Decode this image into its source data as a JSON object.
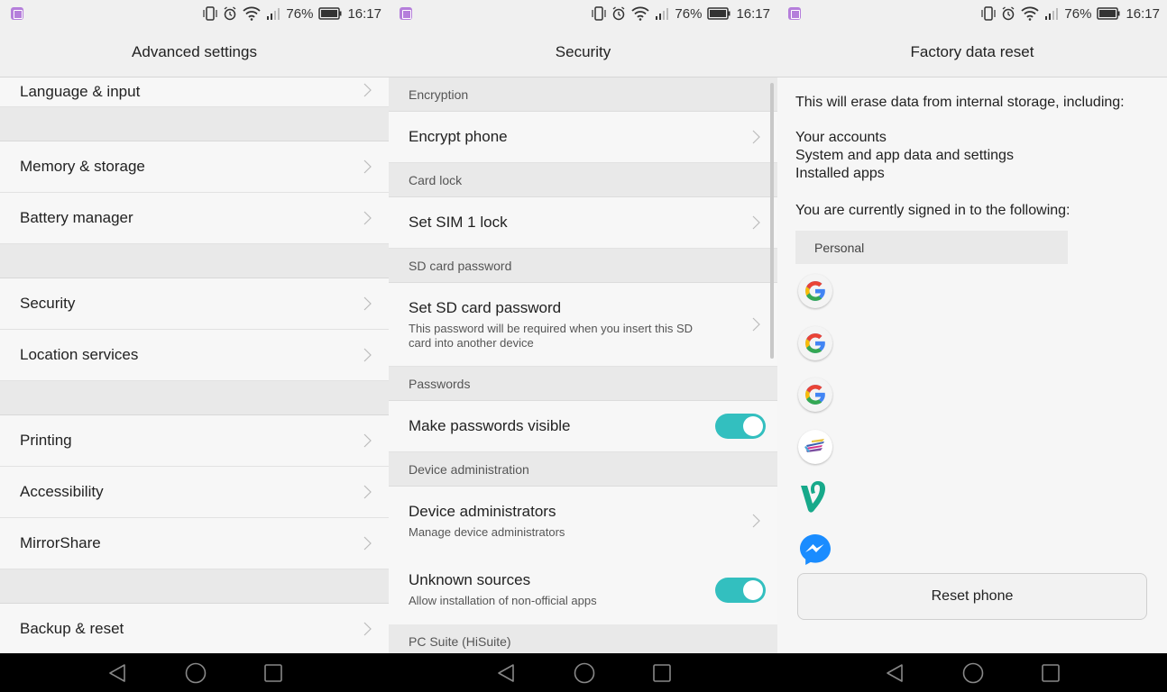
{
  "status_bar": {
    "battery_percent": "76%",
    "time": "16:17",
    "icons": [
      "gallery-notification-icon",
      "vibrate-icon",
      "alarm-icon",
      "wifi-icon",
      "signal-icon",
      "battery-icon"
    ]
  },
  "screens": [
    {
      "title": "Advanced settings",
      "items": [
        {
          "label": "Language & input"
        },
        {
          "label": "Memory & storage"
        },
        {
          "label": "Battery manager"
        },
        {
          "label": "Security"
        },
        {
          "label": "Location services"
        },
        {
          "label": "Printing"
        },
        {
          "label": "Accessibility"
        },
        {
          "label": "MirrorShare"
        },
        {
          "label": "Backup & reset"
        }
      ]
    },
    {
      "title": "Security",
      "sections": {
        "encryption": "Encryption",
        "card_lock": "Card lock",
        "sd_card_password": "SD card password",
        "passwords": "Passwords",
        "device_admin": "Device administration",
        "pc_suite": "PC Suite (HiSuite)"
      },
      "items": {
        "encrypt_phone": {
          "label": "Encrypt phone"
        },
        "set_sim_lock": {
          "label": "Set SIM 1 lock"
        },
        "set_sd_password": {
          "label": "Set SD card password",
          "sub": "This password will be required when you insert this SD card into another device"
        },
        "make_passwords_visible": {
          "label": "Make passwords visible",
          "on": true
        },
        "device_administrators": {
          "label": "Device administrators",
          "sub": "Manage device administrators"
        },
        "unknown_sources": {
          "label": "Unknown sources",
          "sub": "Allow installation of non-official apps",
          "on": true
        }
      },
      "toggle_color": "#33bfbf"
    },
    {
      "title": "Factory data reset",
      "intro": "This will erase data from internal storage, including:",
      "erase_list": [
        "Your accounts",
        "System and app data and settings",
        "Installed apps"
      ],
      "signed_in_label": "You are currently signed in to the following:",
      "account_group": "Personal",
      "accounts": [
        "google-icon",
        "google-icon",
        "google-icon",
        "multicolor-app-icon",
        "vine-icon",
        "messenger-icon"
      ],
      "reset_button": "Reset phone"
    }
  ],
  "nav": {
    "back": "back-icon",
    "home": "home-icon",
    "recents": "recents-icon"
  }
}
